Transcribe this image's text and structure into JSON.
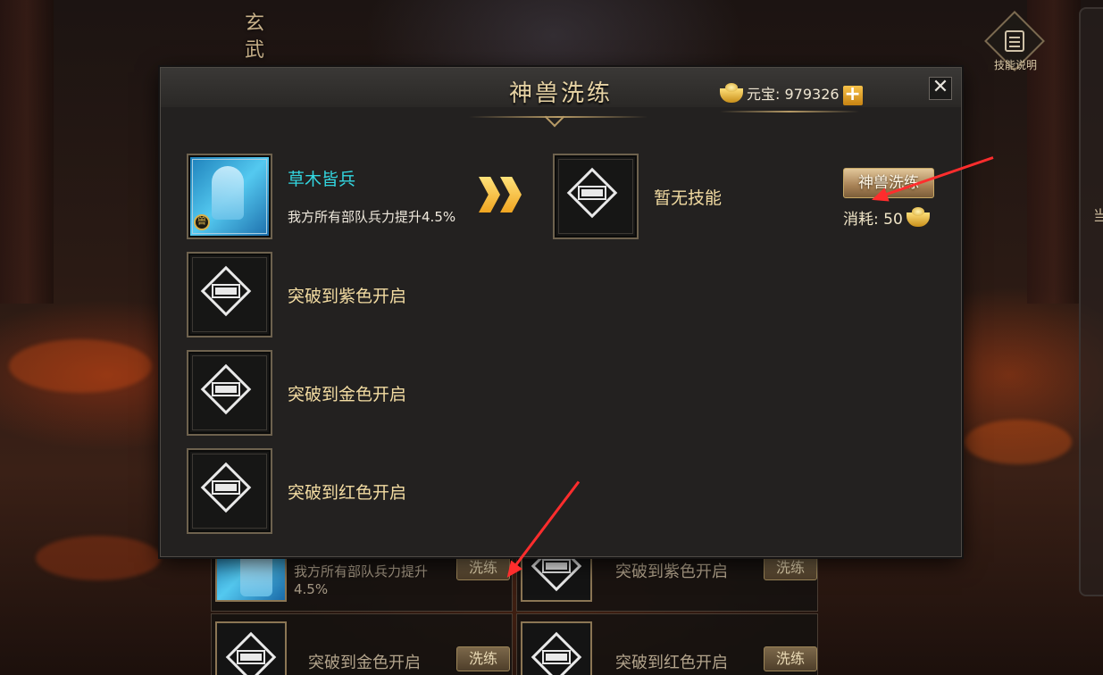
{
  "background": {
    "vertical_title": [
      "玄",
      "武"
    ],
    "skill_info_button": {
      "label": "技能说明",
      "icon": "document-icon"
    },
    "side_char": "当",
    "rows": [
      {
        "desc": "我方所有部队兵力提升4.5%",
        "button": "洗练"
      },
      {
        "text": "突破到紫色开启",
        "button": "洗练"
      },
      {
        "text": "突破到金色开启",
        "button": "洗练"
      },
      {
        "text": "突破到红色开启",
        "button": "洗练"
      }
    ]
  },
  "modal": {
    "title": "神兽洗练",
    "currency": {
      "label": "元宝",
      "value": "979326",
      "icon": "gold-ingot-icon",
      "plus_label": "+"
    },
    "close_label": "✕",
    "current_skill": {
      "name": "草木皆兵",
      "desc": "我方所有部队兵力提升4.5%",
      "badge": "兽"
    },
    "new_skill": {
      "text": "暂无技能"
    },
    "wash_button": "神兽洗练",
    "cost": {
      "label": "消耗",
      "value": "50"
    },
    "locked_slots": [
      "突破到紫色开启",
      "突破到金色开启",
      "突破到红色开启"
    ]
  },
  "colors": {
    "accent_cyan": "#33d6e0",
    "gold": "#f3dca2",
    "annotation_red": "#ff2d2d"
  }
}
